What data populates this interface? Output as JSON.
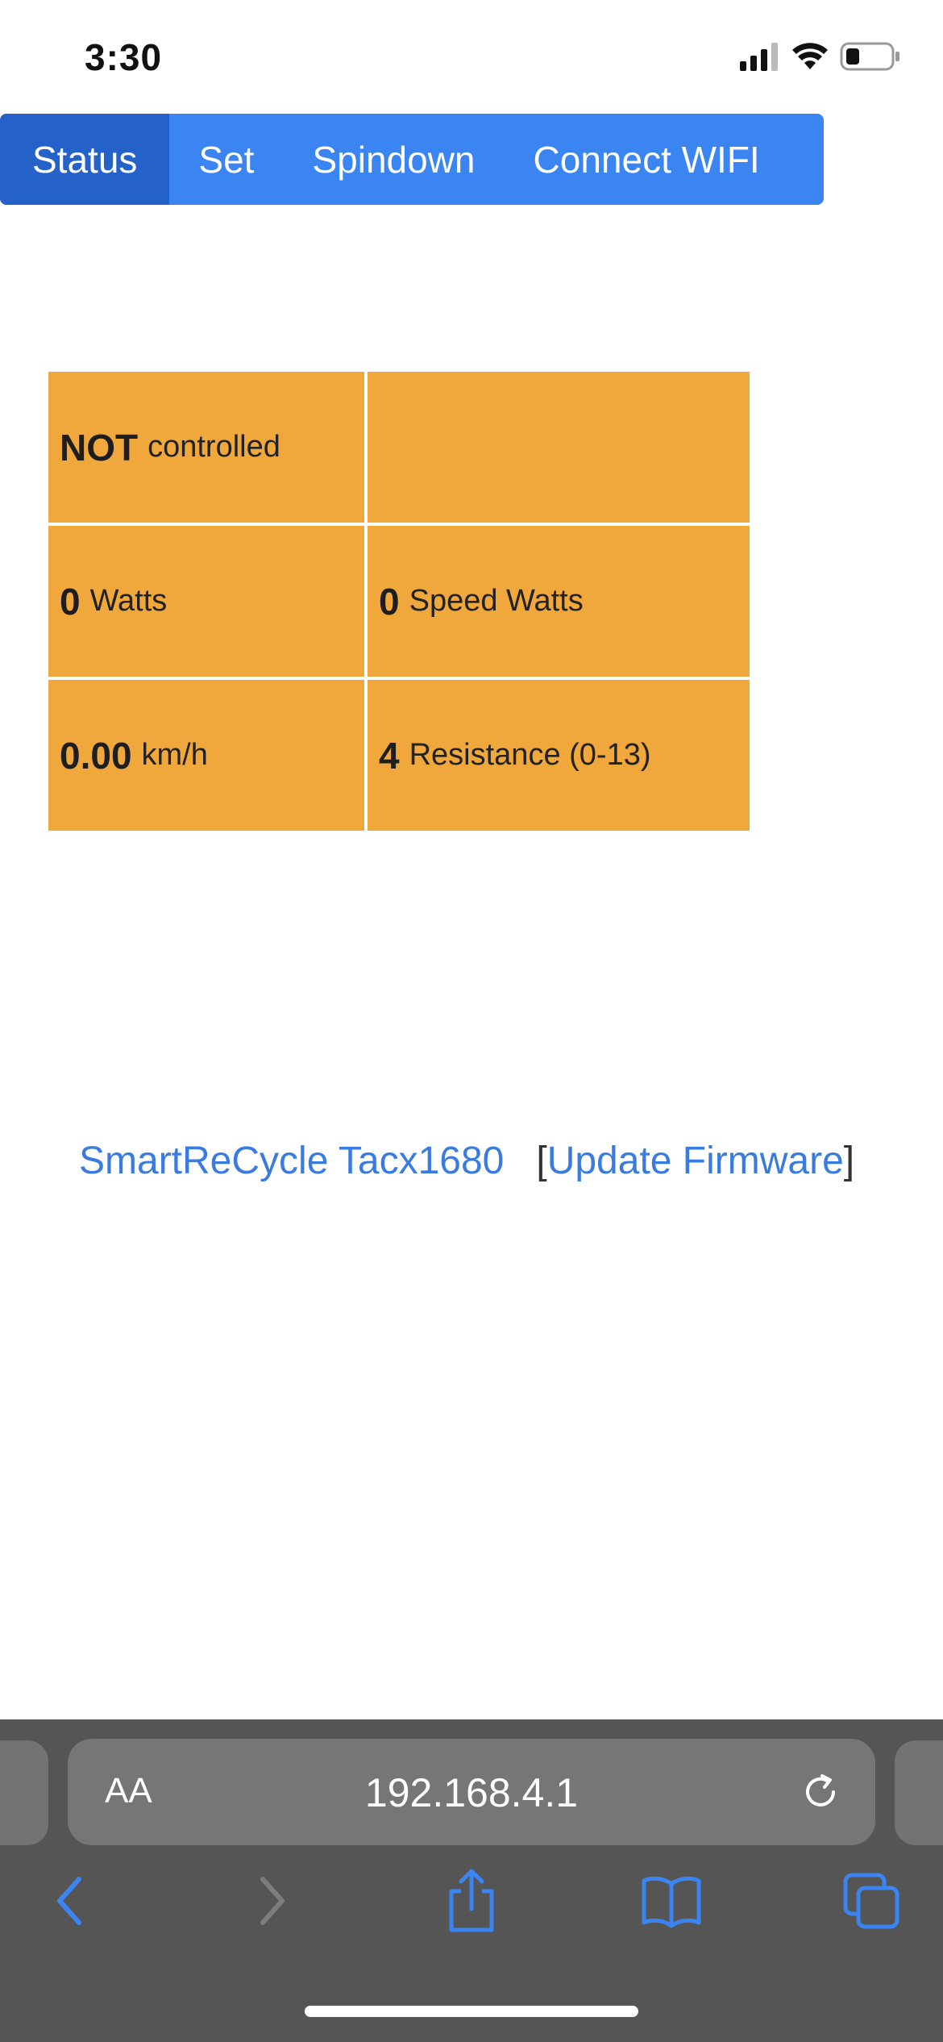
{
  "status_bar": {
    "time": "3:30",
    "icons": [
      "cellular-signal-icon",
      "wifi-icon",
      "battery-icon"
    ]
  },
  "nav": {
    "items": [
      {
        "label": "Status",
        "active": true
      },
      {
        "label": "Set",
        "active": false
      },
      {
        "label": "Spindown",
        "active": false
      },
      {
        "label": "Connect WIFI",
        "active": false
      }
    ]
  },
  "status_table": {
    "rows": [
      [
        {
          "value": "NOT",
          "unit": "controlled"
        },
        {
          "value": "",
          "unit": ""
        }
      ],
      [
        {
          "value": "0",
          "unit": "Watts"
        },
        {
          "value": "0",
          "unit": "Speed Watts"
        }
      ],
      [
        {
          "value": "0.00",
          "unit": "km/h"
        },
        {
          "value": "4",
          "unit": "Resistance (0-13)"
        }
      ]
    ]
  },
  "footer": {
    "device_link": "SmartReCycle Tacx1680",
    "bracket_open": "[",
    "update_link": "Update Firmware",
    "bracket_close": "]"
  },
  "browser": {
    "text_size_label": "AA",
    "url": "192.168.4.1",
    "toolbar_icons": [
      "back-icon",
      "forward-icon",
      "share-icon",
      "bookmarks-icon",
      "tabs-icon"
    ]
  },
  "colors": {
    "nav_bg": "#3a85f2",
    "nav_active_bg": "#2461c8",
    "cell_bg": "#f0a83c",
    "link": "#3a7be0",
    "browser_bar": "#555555"
  }
}
